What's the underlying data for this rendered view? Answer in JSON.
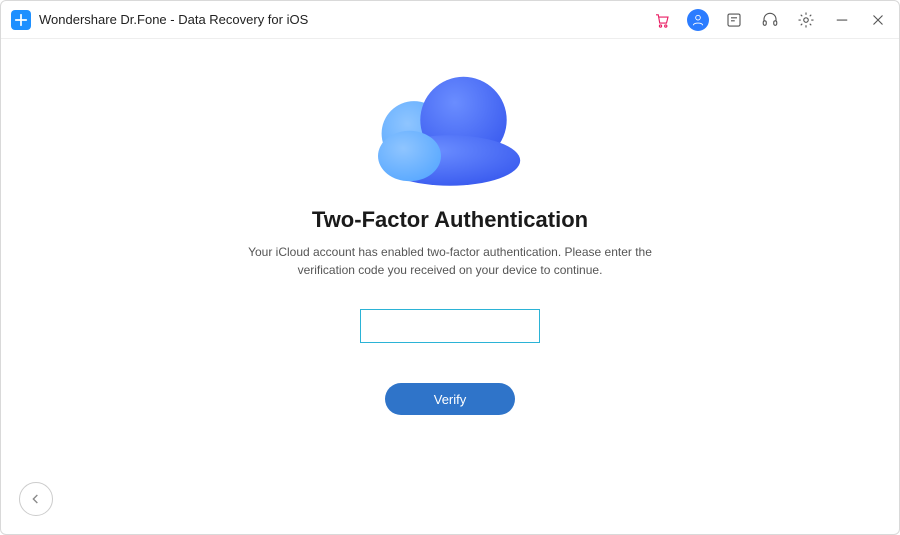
{
  "titlebar": {
    "app_title": "Wondershare Dr.Fone - Data Recovery for iOS",
    "icons": {
      "cart": "cart-icon",
      "user": "user-icon",
      "feedback": "feedback-icon",
      "support": "support-icon",
      "settings": "settings-icon",
      "minimize": "minimize-icon",
      "close": "close-icon"
    }
  },
  "main": {
    "heading": "Two-Factor Authentication",
    "subtext": "Your iCloud account has enabled two-factor authentication. Please enter the verification code you received on your device to continue.",
    "code_value": "",
    "verify_label": "Verify"
  },
  "footer": {
    "back_icon": "back-icon"
  },
  "colors": {
    "accent": "#2f74c9",
    "input_border": "#2bb3d6",
    "cart_pink": "#e91e63",
    "user_blue": "#2b7cff"
  }
}
